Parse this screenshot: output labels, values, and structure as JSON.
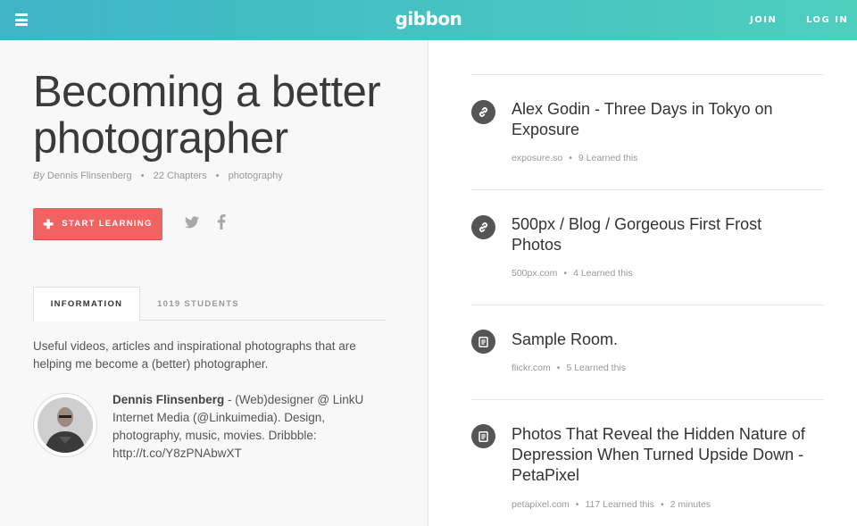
{
  "header": {
    "logo": "gibbon",
    "join_label": "JOIN",
    "login_label": "LOG IN",
    "accent_gradient": [
      "#3fb4c8",
      "#4ecfbd"
    ]
  },
  "course": {
    "title": "Becoming a better photographer",
    "by_label": "By",
    "author": "Dennis Flinsenberg",
    "chapters": "22 Chapters",
    "tag": "photography",
    "start_label": "START LEARNING",
    "start_color": "#f16263",
    "share_icons": [
      "twitter-icon",
      "facebook-icon"
    ],
    "tabs": [
      {
        "label": "INFORMATION",
        "active": true
      },
      {
        "label": "1019 STUDENTS",
        "active": false
      }
    ],
    "description": "Useful videos, articles and inspirational photographs that are helping me become a (better) photographer.",
    "bio_name": "Dennis Flinsenberg",
    "bio_text": " - (Web)designer @ LinkU Internet Media (@Linkuimedia). Design, photography, music, movies. Dribbble: http://t.co/Y8zPNAbwXT"
  },
  "chapters": [
    {
      "icon": "link-icon",
      "title": "Alex Godin - Three Days in Tokyo on Exposure",
      "source": "exposure.so",
      "learned": "9 Learned this",
      "duration": ""
    },
    {
      "icon": "link-icon",
      "title": "500px / Blog / Gorgeous First Frost Photos",
      "source": "500px.com",
      "learned": "4 Learned this",
      "duration": ""
    },
    {
      "icon": "document-icon",
      "title": "Sample Room.",
      "source": "flickr.com",
      "learned": "5 Learned this",
      "duration": ""
    },
    {
      "icon": "document-icon",
      "title": "Photos That Reveal the Hidden Nature of Depression When Turned Upside Down - PetaPixel",
      "source": "petapixel.com",
      "learned": "117 Learned this",
      "duration": "2 minutes"
    }
  ]
}
